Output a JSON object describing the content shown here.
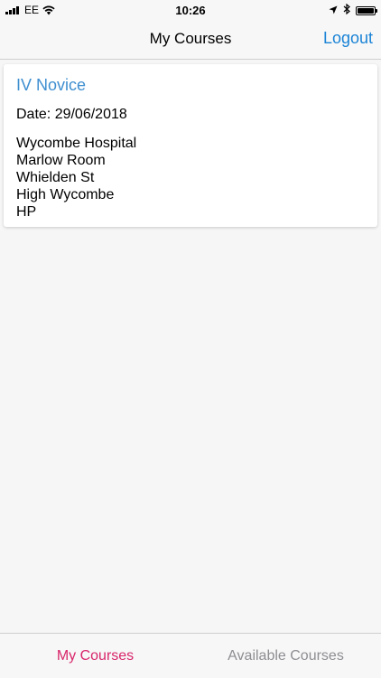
{
  "status_bar": {
    "carrier": "EE",
    "time": "10:26",
    "icons": [
      "signal-icon",
      "wifi-icon",
      "location-icon",
      "bluetooth-icon",
      "battery-icon"
    ],
    "battery_level": 1.0
  },
  "nav": {
    "title": "My Courses",
    "logout_label": "Logout",
    "accent_color": "#1a83d6"
  },
  "courses": [
    {
      "title": "IV Novice",
      "date": "Date: 29/06/2018",
      "address": [
        "Wycombe Hospital",
        "Marlow Room",
        "Whielden St",
        "High Wycombe",
        "HP"
      ]
    }
  ],
  "tabs": {
    "items": [
      {
        "label": "My Courses",
        "active": true
      },
      {
        "label": "Available Courses",
        "active": false
      }
    ],
    "active_color": "#d8266b",
    "inactive_color": "#8e8e93"
  }
}
